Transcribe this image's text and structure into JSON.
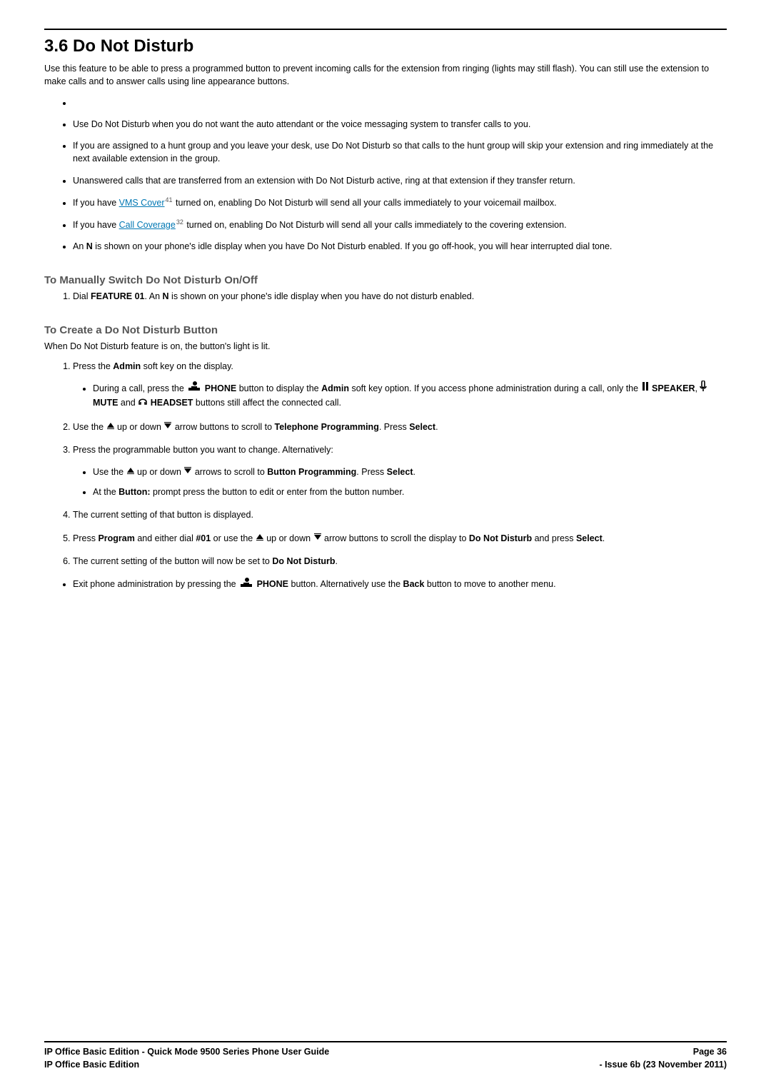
{
  "section": {
    "number": "3.6",
    "title": "Do Not Disturb",
    "full_title": "3.6 Do Not Disturb"
  },
  "intro": "Use this feature to be able to press a programmed button to prevent incoming calls for the extension from ringing (lights may still flash). You can still use the extension to make calls and to answer calls using line appearance buttons.",
  "bullets": [
    "",
    "Use Do Not Disturb when you do not want the auto attendant or the voice messaging system to transfer calls to you.",
    "If you are assigned to a hunt group and you leave your desk, use Do Not Disturb so that calls to the hunt group will skip your extension and ring immediately at the next available extension in the group.",
    "Unanswered calls that are transferred from an extension with Do Not Disturb active, ring at that extension if they transfer return."
  ],
  "bullet_vms": {
    "pre": "If you have ",
    "link": "VMS Cover",
    "ref": "41",
    "post": " turned on, enabling Do Not Disturb will send all your calls immediately to your voicemail mailbox."
  },
  "bullet_cc": {
    "pre": "If you have ",
    "link": "Call Coverage",
    "ref": "32",
    "post": " turned on, enabling Do Not Disturb will send all your calls immediately to the covering extension."
  },
  "bullet_n": {
    "pre": "An ",
    "b": "N",
    "post": " is shown on your phone's idle display when you have Do Not Disturb enabled. If you go off-hook, you will hear interrupted dial tone."
  },
  "manual": {
    "heading": "To Manually Switch Do Not Disturb On/Off",
    "step1_pre": "Dial ",
    "step1_feature": "FEATURE 01",
    "step1_mid": ". An ",
    "step1_n": "N",
    "step1_post": " is shown on your phone's idle display when you have do not disturb enabled."
  },
  "create": {
    "heading": "To Create a Do Not Disturb Button",
    "whenlit": "When Do Not Disturb feature is on, the button's light is lit.",
    "step1_pre": "Press the ",
    "step1_b": "Admin",
    "step1_post": " soft key on the display.",
    "step1a": {
      "pre": "During a call, press the ",
      "phone": "PHONE",
      "mid1": " button to display the ",
      "admin": "Admin",
      "mid2": " soft key option. If you access phone administration during a call, only the ",
      "speaker": "SPEAKER",
      "c1": ", ",
      "mute": "MUTE",
      "c2": " and ",
      "headset": "HEADSET",
      "post": " buttons still affect the connected call."
    },
    "step2": {
      "pre": "Use the ",
      "up_text": " up or down ",
      "mid": " arrow buttons to scroll to ",
      "tp": "Telephone Programming",
      "post": ". Press ",
      "select": "Select",
      "end": "."
    },
    "step3": {
      "text": "Press the programmable button you want to change. Alternatively:",
      "a_pre": "Use the ",
      "a_mid1": " up or down ",
      "a_mid2": " arrows to scroll to ",
      "a_bp": "Button Programming",
      "a_post": ". Press ",
      "a_select": "Select",
      "a_end": ".",
      "b_pre": "At the ",
      "b_btn": "Button:",
      "b_post": " prompt press the button to edit or enter from the button number."
    },
    "step4": "The current setting of that button is displayed.",
    "step5": {
      "pre": "Press ",
      "program": "Program",
      "mid1": " and either dial ",
      "code": "#01",
      "mid2": " or use the ",
      "mid3": " up or down ",
      "mid4": " arrow buttons to scroll the display to ",
      "dnd": "Do Not Disturb",
      "mid5": " and press ",
      "select": "Select",
      "end": "."
    },
    "step6": {
      "pre": "The current setting of the button will now be set to ",
      "dnd": "Do Not Disturb",
      "end": "."
    },
    "exit": {
      "pre": "Exit phone administration by pressing the ",
      "phone": "PHONE",
      "mid": " button. Alternatively use the ",
      "back": "Back",
      "post": " button to move to another menu."
    }
  },
  "footer": {
    "left1": "IP Office Basic Edition - Quick Mode 9500 Series Phone User Guide",
    "right1": "Page 36",
    "left2": "IP Office Basic Edition",
    "right2": "- Issue 6b (23 November 2011)"
  }
}
